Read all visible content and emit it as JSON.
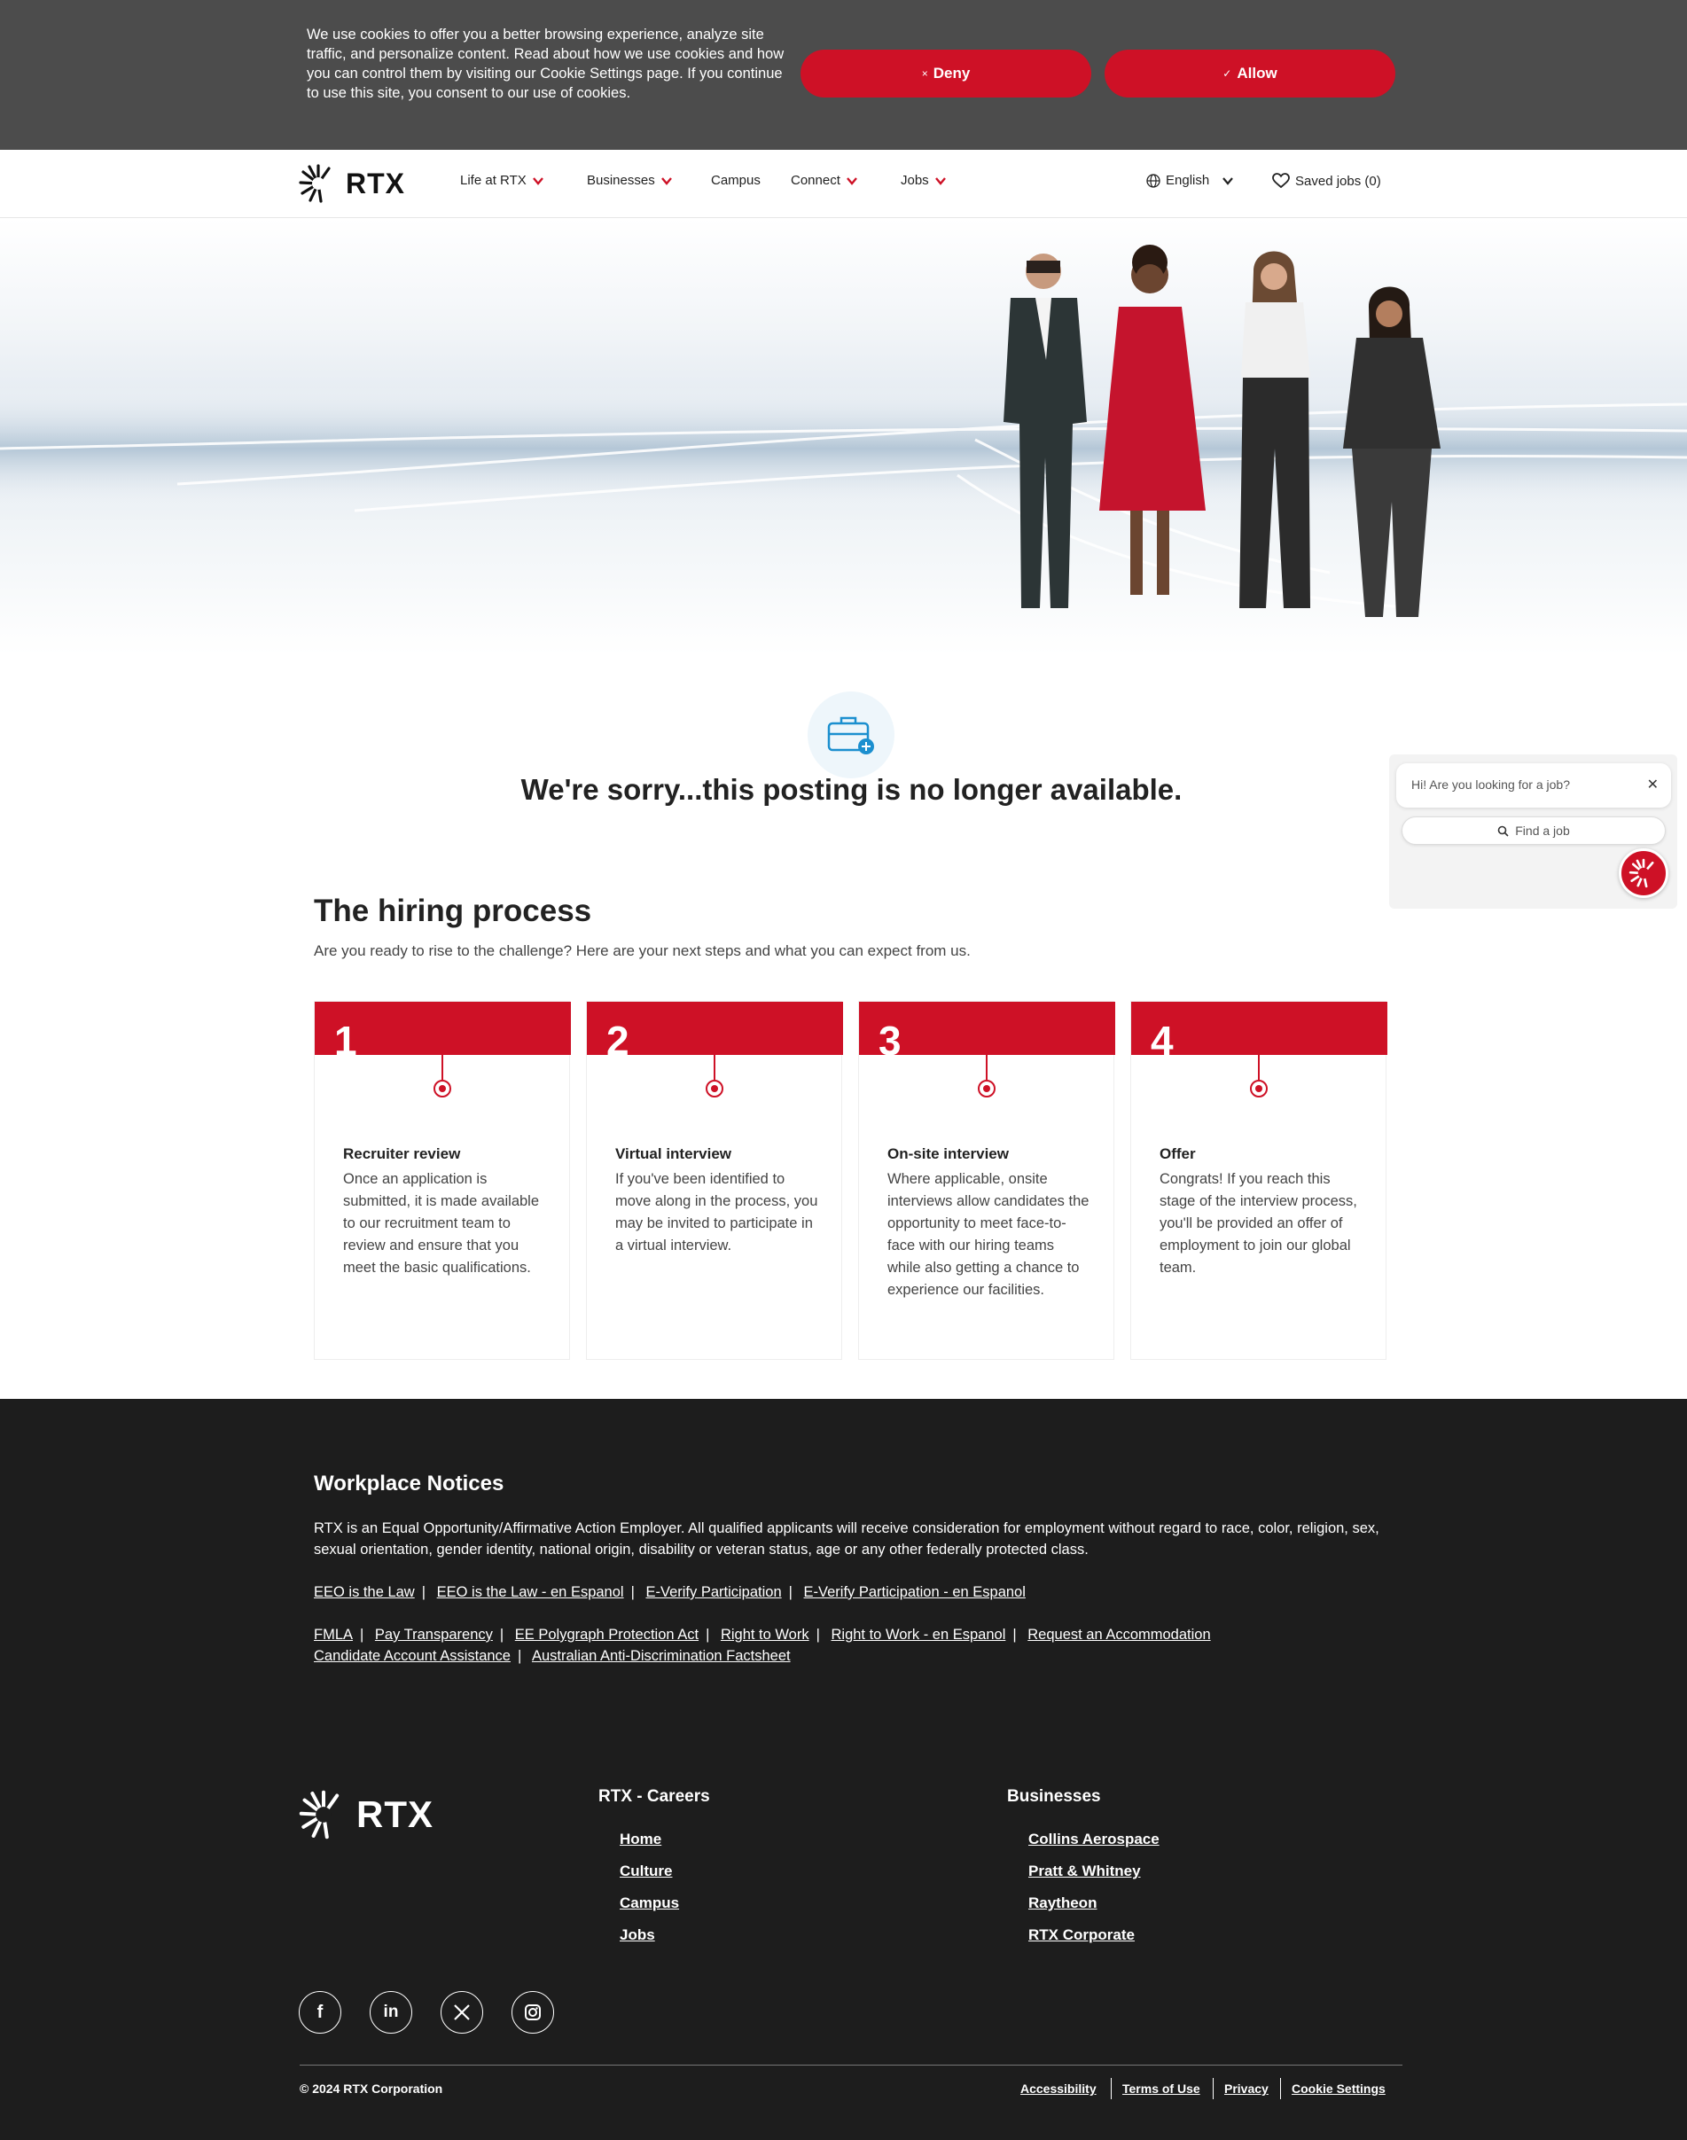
{
  "cookie_banner": {
    "text": "We use cookies to offer you a better browsing experience, analyze site traffic, and personalize content. Read about how we use cookies and how you can control them by visiting our Cookie Settings page. If you continue to use this site, you consent to our use of cookies.",
    "deny_label": "Deny",
    "allow_label": "Allow",
    "deny_icon": "×",
    "allow_icon": "✓"
  },
  "header": {
    "logo_text": "RTX",
    "nav": [
      {
        "label": "Life at RTX",
        "has_dropdown": true
      },
      {
        "label": "Businesses",
        "has_dropdown": true
      },
      {
        "label": "Campus",
        "has_dropdown": false
      },
      {
        "label": "Connect",
        "has_dropdown": true
      },
      {
        "label": "Jobs",
        "has_dropdown": true
      }
    ],
    "language": "English",
    "saved_jobs": "Saved jobs (0)"
  },
  "main": {
    "sorry_title": "We're sorry...this posting is no longer available.",
    "hiring_title": "The hiring process",
    "hiring_subtitle": "Are you ready to rise to the challenge? Here are your next steps and what you can expect from us.",
    "steps": [
      {
        "number": "1",
        "title": "Recruiter review",
        "body": "Once an application is submitted, it is made available to our recruitment team to review and ensure that you meet the basic qualifications."
      },
      {
        "number": "2",
        "title": "Virtual interview",
        "body": "If you've been identified to move along in the process, you may be invited to participate in a virtual interview."
      },
      {
        "number": "3",
        "title": "On-site interview",
        "body": "Where applicable, onsite interviews allow candidates the opportunity to meet face-to-face with our hiring teams while also getting a chance to experience our facilities."
      },
      {
        "number": "4",
        "title": "Offer",
        "body": "Congrats! If you reach this stage of the interview process, you'll be provided an offer of employment to join our global team."
      }
    ]
  },
  "chat": {
    "greeting": "Hi! Are you looking for a job?",
    "find_label": "Find a job"
  },
  "footer": {
    "notices_title": "Workplace Notices",
    "notices_text": "RTX is an Equal Opportunity/Affirmative Action Employer. All qualified applicants will receive consideration for employment without regard to race, color, religion, sex, sexual orientation, gender identity, national origin, disability or veteran status, age or any other federally protected class.",
    "links_row1": [
      "EEO is the Law",
      "EEO is the Law - en Espanol",
      "E-Verify Participation",
      "E-Verify Participation - en Espanol"
    ],
    "links_row2": [
      "FMLA",
      "Pay Transparency",
      "EE Polygraph Protection Act",
      "Right to Work",
      "Right to Work - en Espanol",
      "Request an Accommodation"
    ],
    "links_row3": [
      "Candidate Account Assistance",
      "Australian Anti-Discrimination Factsheet"
    ],
    "logo_text": "RTX",
    "careers_title": "RTX - Careers",
    "careers_links": [
      "Home",
      "Culture",
      "Campus",
      "Jobs"
    ],
    "businesses_title": "Businesses",
    "businesses_links": [
      "Collins Aerospace",
      "Pratt & Whitney",
      "Raytheon",
      "RTX Corporate"
    ],
    "social": [
      "facebook-icon",
      "linkedin-icon",
      "x-icon",
      "instagram-icon"
    ],
    "copyright": "© 2024 RTX Corporation",
    "legal_links": [
      "Accessibility",
      "Terms of Use",
      "Privacy",
      "Cookie Settings"
    ]
  },
  "colors": {
    "brand_red": "#ce1126",
    "cookie_bg": "#4c4c4c",
    "footer_bg": "#1d1d1d"
  }
}
